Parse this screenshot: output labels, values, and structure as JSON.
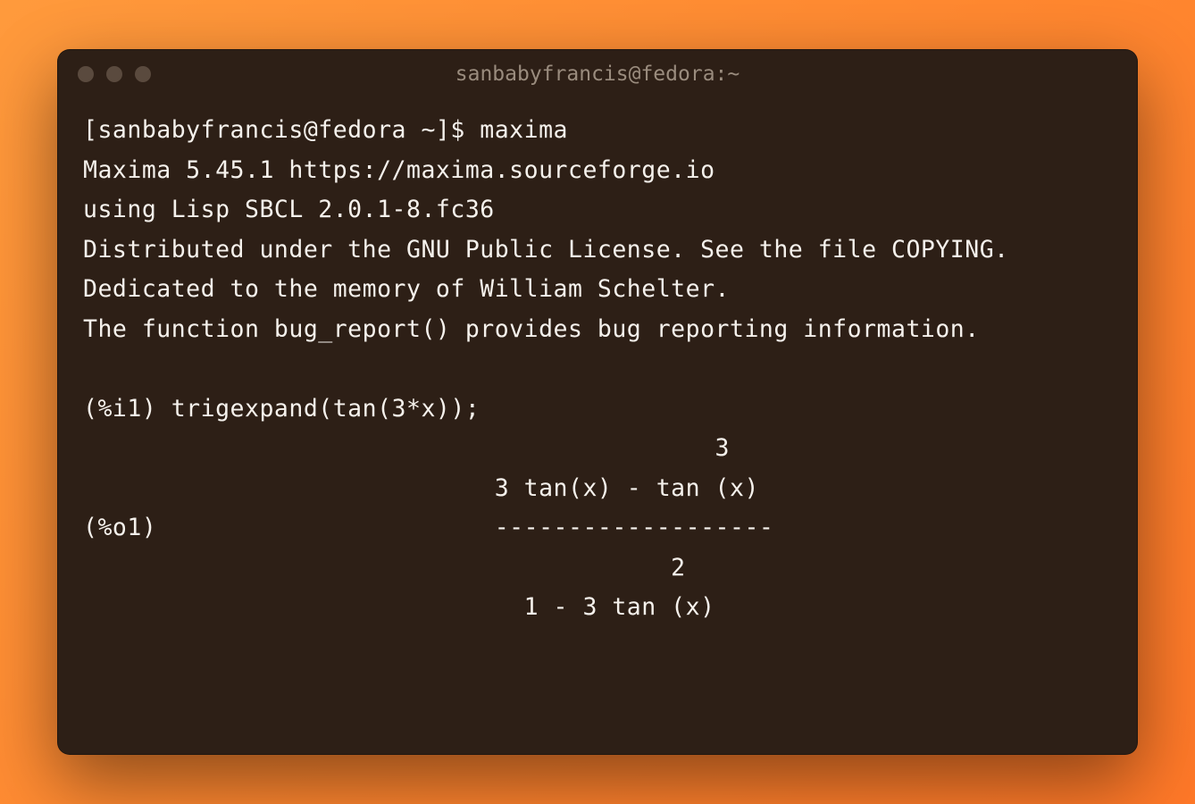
{
  "window": {
    "title": "sanbabyfrancis@fedora:~"
  },
  "terminal": {
    "lines": {
      "prompt": "[sanbabyfrancis@fedora ~]$ maxima",
      "banner1": "Maxima 5.45.1 https://maxima.sourceforge.io",
      "banner2": "using Lisp SBCL 2.0.1-8.fc36",
      "banner3": "Distributed under the GNU Public License. See the file COPYING.",
      "banner4": "Dedicated to the memory of William Schelter.",
      "banner5": "The function bug_report() provides bug reporting information.",
      "blank": "",
      "input1": "(%i1) trigexpand(tan(3*x));",
      "out_exp_top": "                                           3",
      "out_numer": "                            3 tan(x) - tan (x)",
      "out_label_frac": "(%o1)                       -------------------",
      "out_exp_bot": "                                        2",
      "out_denom": "                              1 - 3 tan (x)"
    }
  }
}
